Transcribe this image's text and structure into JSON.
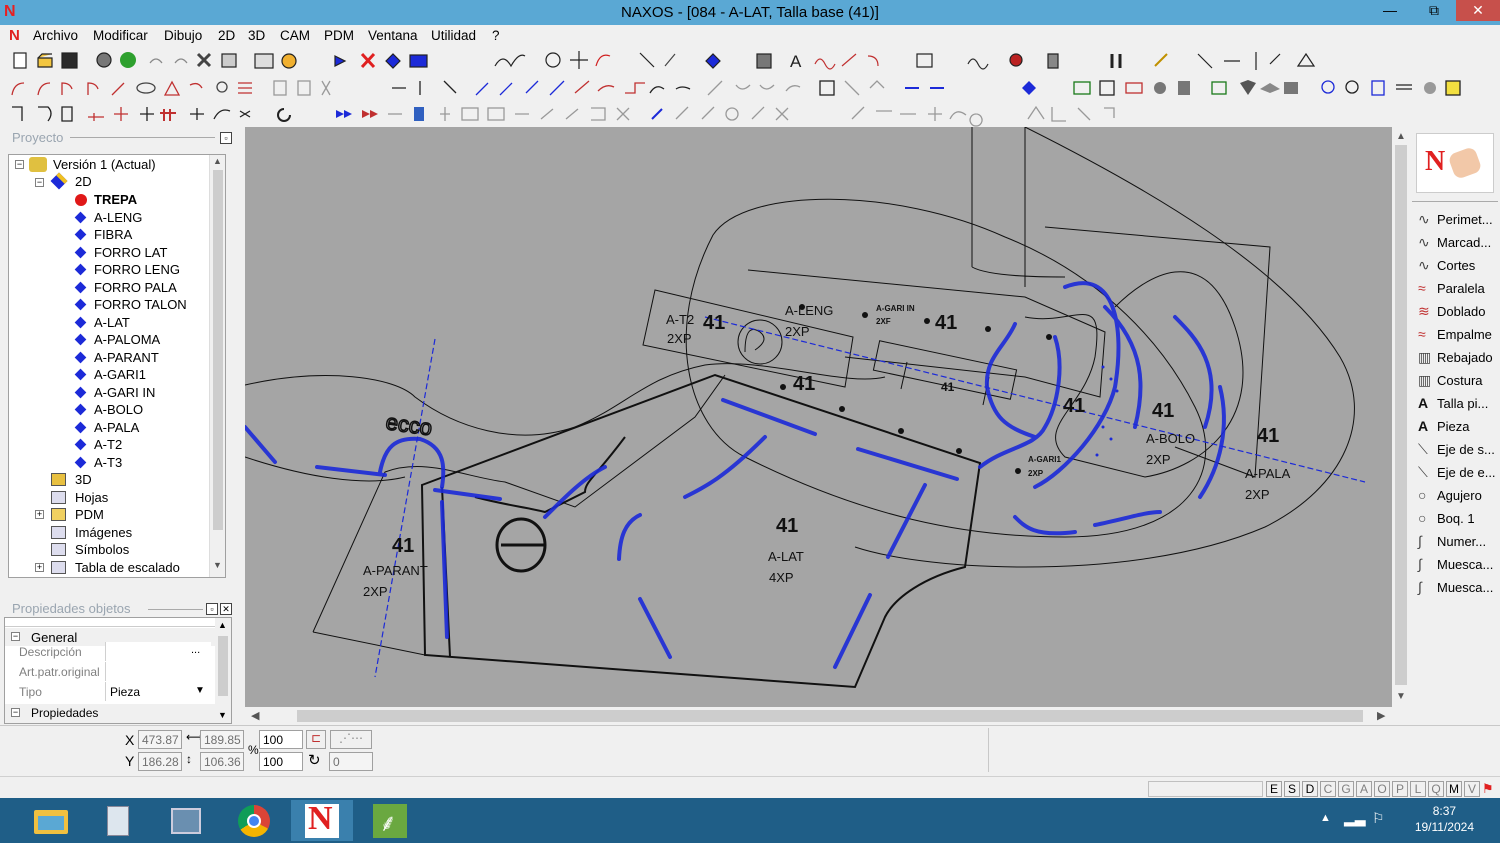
{
  "window": {
    "title": "NAXOS - [084 - A-LAT, Talla base (41)]",
    "logo": "N",
    "min": "—",
    "max": "⧉",
    "close": "✕"
  },
  "menu": [
    "Archivo",
    "Modificar",
    "Dibujo",
    "2D",
    "3D",
    "CAM",
    "PDM",
    "Ventana",
    "Utilidad",
    "?"
  ],
  "project": {
    "title": "Proyecto",
    "root": "Versión 1 (Actual)",
    "node2d": "2D",
    "pieces": [
      "TREPA",
      "A-LENG",
      "FIBRA",
      "FORRO LAT",
      "FORRO LENG",
      "FORRO PALA",
      "FORRO TALON",
      "A-LAT",
      "A-PALOMA",
      "A-PARANT",
      "A-GARI1",
      "A-GARI IN",
      "A-BOLO",
      "A-PALA",
      "A-T2",
      "A-T3"
    ],
    "others": [
      "3D",
      "Hojas",
      "PDM",
      "Imágenes",
      "Símbolos",
      "Tabla de escalado"
    ]
  },
  "properties": {
    "title": "Propiedades objetos",
    "section": "General",
    "rows": [
      {
        "key": "Descripción",
        "value": "",
        "btn": "..."
      },
      {
        "key": "Art.patr.original",
        "value": ""
      },
      {
        "key": "Tipo",
        "value": "Pieza"
      }
    ],
    "section2": "Propiedades"
  },
  "right_tools": [
    "Perimet...",
    "Marcad...",
    "Cortes",
    "Paralela",
    "Doblado",
    "Empalme",
    "Rebajado",
    "Costura",
    "Talla pi...",
    "Pieza",
    "Eje de s...",
    "Eje de e...",
    "Agujero",
    "Boq. 1",
    "Numer...",
    "Muesca...",
    "Muesca..."
  ],
  "right_tool_icons": [
    "curve-icon",
    "curve-icon",
    "curve-icon",
    "parallel-icon",
    "fold-icon",
    "join-icon",
    "skive-icon",
    "stitch-icon",
    "text-icon",
    "text-icon",
    "axis-icon",
    "axis-icon",
    "circle-icon",
    "circle-icon",
    "pen-icon",
    "pen-icon",
    "pen-icon"
  ],
  "coords": {
    "x_label": "X",
    "y_label": "Y",
    "x": "473.87",
    "y": "186.28",
    "w": "189.85",
    "h": "106.36",
    "sx": "100",
    "sy": "100",
    "pct": "%",
    "rot": "0"
  },
  "status_keys": [
    "E",
    "S",
    "D",
    "C",
    "G",
    "A",
    "O",
    "P",
    "L",
    "Q",
    "M",
    "V"
  ],
  "status_keys_on": [
    "E",
    "S",
    "D",
    "M"
  ],
  "clock": {
    "time": "8:37",
    "date": "19/11/2024"
  },
  "drawing": {
    "labels": [
      {
        "t": "41",
        "cls": "big"
      },
      {
        "t": "A-T2",
        "cls": "mid"
      },
      {
        "t": "2XP",
        "cls": "mid"
      },
      {
        "t": "A-LENG",
        "cls": "mid"
      },
      {
        "t": "2XP",
        "cls": "mid"
      },
      {
        "t": "A-GARI IN",
        "cls": "tiny"
      },
      {
        "t": "2XF",
        "cls": "tiny"
      },
      {
        "t": "41",
        "cls": "big"
      },
      {
        "t": "41",
        "cls": "big"
      },
      {
        "t": "41",
        "cls": "small"
      },
      {
        "t": "41",
        "cls": "big"
      },
      {
        "t": "41",
        "cls": "big"
      },
      {
        "t": "A-BOLO",
        "cls": "mid"
      },
      {
        "t": "2XP",
        "cls": "mid"
      },
      {
        "t": "41",
        "cls": "big"
      },
      {
        "t": "A-PALA",
        "cls": "mid"
      },
      {
        "t": "2XP",
        "cls": "mid"
      },
      {
        "t": "A-GARI1",
        "cls": "tiny"
      },
      {
        "t": "2XP",
        "cls": "tiny"
      },
      {
        "t": "41",
        "cls": "big"
      },
      {
        "t": "A-LAT",
        "cls": "mid"
      },
      {
        "t": "4XP",
        "cls": "mid"
      },
      {
        "t": "41",
        "cls": "big"
      },
      {
        "t": "A-PARANT",
        "cls": "mid"
      },
      {
        "t": "2XP",
        "cls": "mid"
      },
      {
        "t": "ecco",
        "cls": "logo"
      }
    ]
  }
}
